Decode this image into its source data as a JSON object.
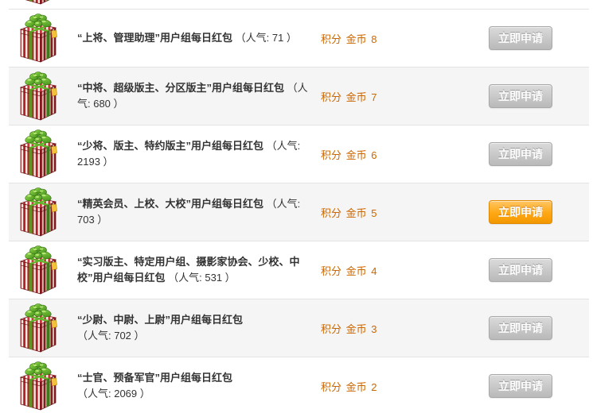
{
  "icons": {
    "row_icon": "gift-box-icon"
  },
  "colors": {
    "reward_text": "#cc6600",
    "button_default": "#c3c3c3",
    "button_highlight": "#ffa000",
    "row_alt": "#f5f5f5",
    "row_border": "#e3e3e3"
  },
  "items": [
    {
      "title": "“上将、管理助理”用户组每日红包",
      "popularity": "（人气: 71 ）",
      "reward": {
        "type": "积分",
        "currency": "金币",
        "amount": "8"
      },
      "button": "立即申请",
      "highlighted": false
    },
    {
      "title": "“中将、超级版主、分区版主”用户组每日红包",
      "popularity": "（人气: 680 ）",
      "reward": {
        "type": "积分",
        "currency": "金币",
        "amount": "7"
      },
      "button": "立即申请",
      "highlighted": false
    },
    {
      "title": "“少将、版主、特约版主”用户组每日红包",
      "popularity": "（人气: 2193 ）",
      "reward": {
        "type": "积分",
        "currency": "金币",
        "amount": "6"
      },
      "button": "立即申请",
      "highlighted": false
    },
    {
      "title": "“精英会员、上校、大校”用户组每日红包",
      "popularity": "（人气: 703 ）",
      "reward": {
        "type": "积分",
        "currency": "金币",
        "amount": "5"
      },
      "button": "立即申请",
      "highlighted": true
    },
    {
      "title": "“实习版主、特定用户组、摄影家协会、少校、中校”用户组每日红包",
      "popularity": "（人气: 531 ）",
      "reward": {
        "type": "积分",
        "currency": "金币",
        "amount": "4"
      },
      "button": "立即申请",
      "highlighted": false
    },
    {
      "title": "“少尉、中尉、上尉”用户组每日红包",
      "popularity": "（人气: 702 ）",
      "reward": {
        "type": "积分",
        "currency": "金币",
        "amount": "3"
      },
      "button": "立即申请",
      "highlighted": false
    },
    {
      "title": "“士官、预备军官”用户组每日红包",
      "popularity": "（人气: 2069 ）",
      "reward": {
        "type": "积分",
        "currency": "金币",
        "amount": "2"
      },
      "button": "立即申请",
      "highlighted": false
    }
  ]
}
